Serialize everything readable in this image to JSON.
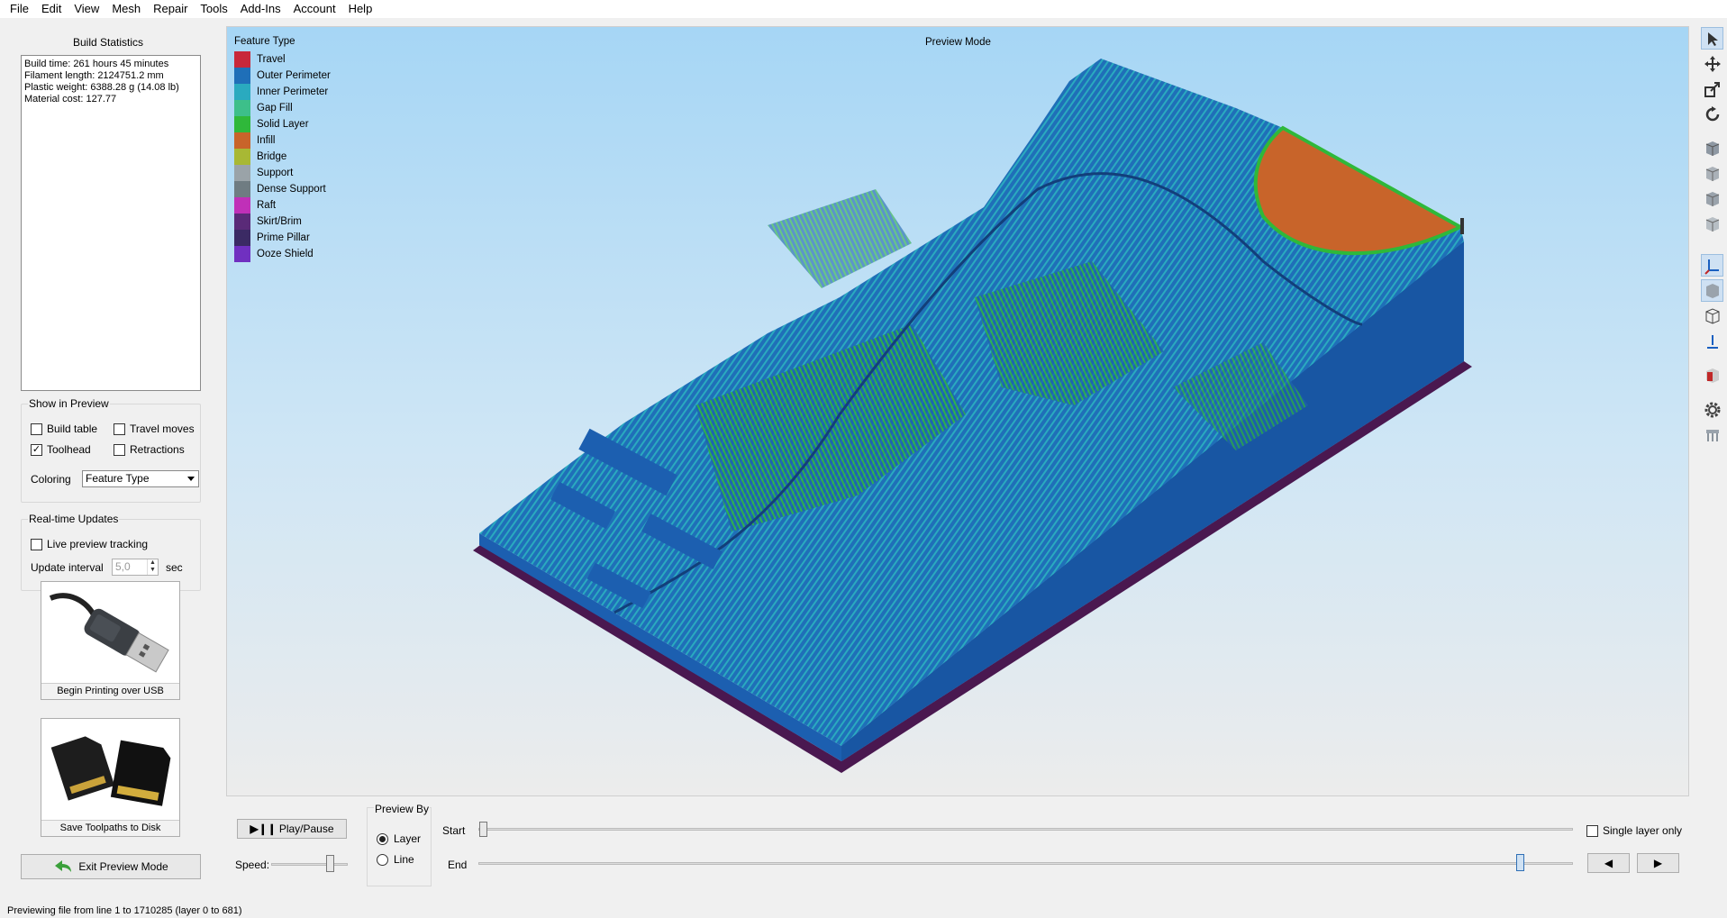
{
  "menu": [
    "File",
    "Edit",
    "View",
    "Mesh",
    "Repair",
    "Tools",
    "Add-Ins",
    "Account",
    "Help"
  ],
  "build_stats": {
    "title": "Build Statistics",
    "lines": [
      "Build time: 261 hours 45 minutes",
      "Filament length: 2124751.2 mm",
      "Plastic weight: 6388.28 g (14.08 lb)",
      "Material cost: 127.77"
    ]
  },
  "show_in_preview": {
    "title": "Show in Preview",
    "build_table": "Build table",
    "travel_moves": "Travel moves",
    "toolhead": "Toolhead",
    "retractions": "Retractions",
    "coloring_label": "Coloring",
    "coloring_value": "Feature Type",
    "checked": {
      "build_table": false,
      "travel_moves": false,
      "toolhead": true,
      "retractions": false
    }
  },
  "realtime": {
    "title": "Real-time Updates",
    "live_tracking": "Live preview tracking",
    "interval_label": "Update interval",
    "interval_value": "5,0",
    "interval_unit": "sec"
  },
  "usb_button": "Begin Printing over USB",
  "disk_button": "Save Toolpaths to Disk",
  "exit_button": "Exit Preview Mode",
  "viewport": {
    "mode_label": "Preview Mode",
    "legend_title": "Feature Type",
    "legend": [
      {
        "label": "Travel",
        "color": "#c8283a"
      },
      {
        "label": "Outer Perimeter",
        "color": "#1f6fb8"
      },
      {
        "label": "Inner Perimeter",
        "color": "#2aaabf"
      },
      {
        "label": "Gap Fill",
        "color": "#3dbf8a"
      },
      {
        "label": "Solid Layer",
        "color": "#2fb83a"
      },
      {
        "label": "Infill",
        "color": "#c8642a"
      },
      {
        "label": "Bridge",
        "color": "#a8b834"
      },
      {
        "label": "Support",
        "color": "#9aa3a8"
      },
      {
        "label": "Dense Support",
        "color": "#6f7c82"
      },
      {
        "label": "Raft",
        "color": "#c030b8"
      },
      {
        "label": "Skirt/Brim",
        "color": "#5a2a78"
      },
      {
        "label": "Prime Pillar",
        "color": "#3b2a64"
      },
      {
        "label": "Ooze Shield",
        "color": "#7030c0"
      }
    ]
  },
  "controls": {
    "play_pause": "Play/Pause",
    "speed_label": "Speed:",
    "preview_by_title": "Preview By",
    "layer": "Layer",
    "line": "Line",
    "start_label": "Start",
    "end_label": "End",
    "single_layer": "Single layer only"
  },
  "status": "Previewing file from line 1 to 1710285 (layer 0 to 681)"
}
